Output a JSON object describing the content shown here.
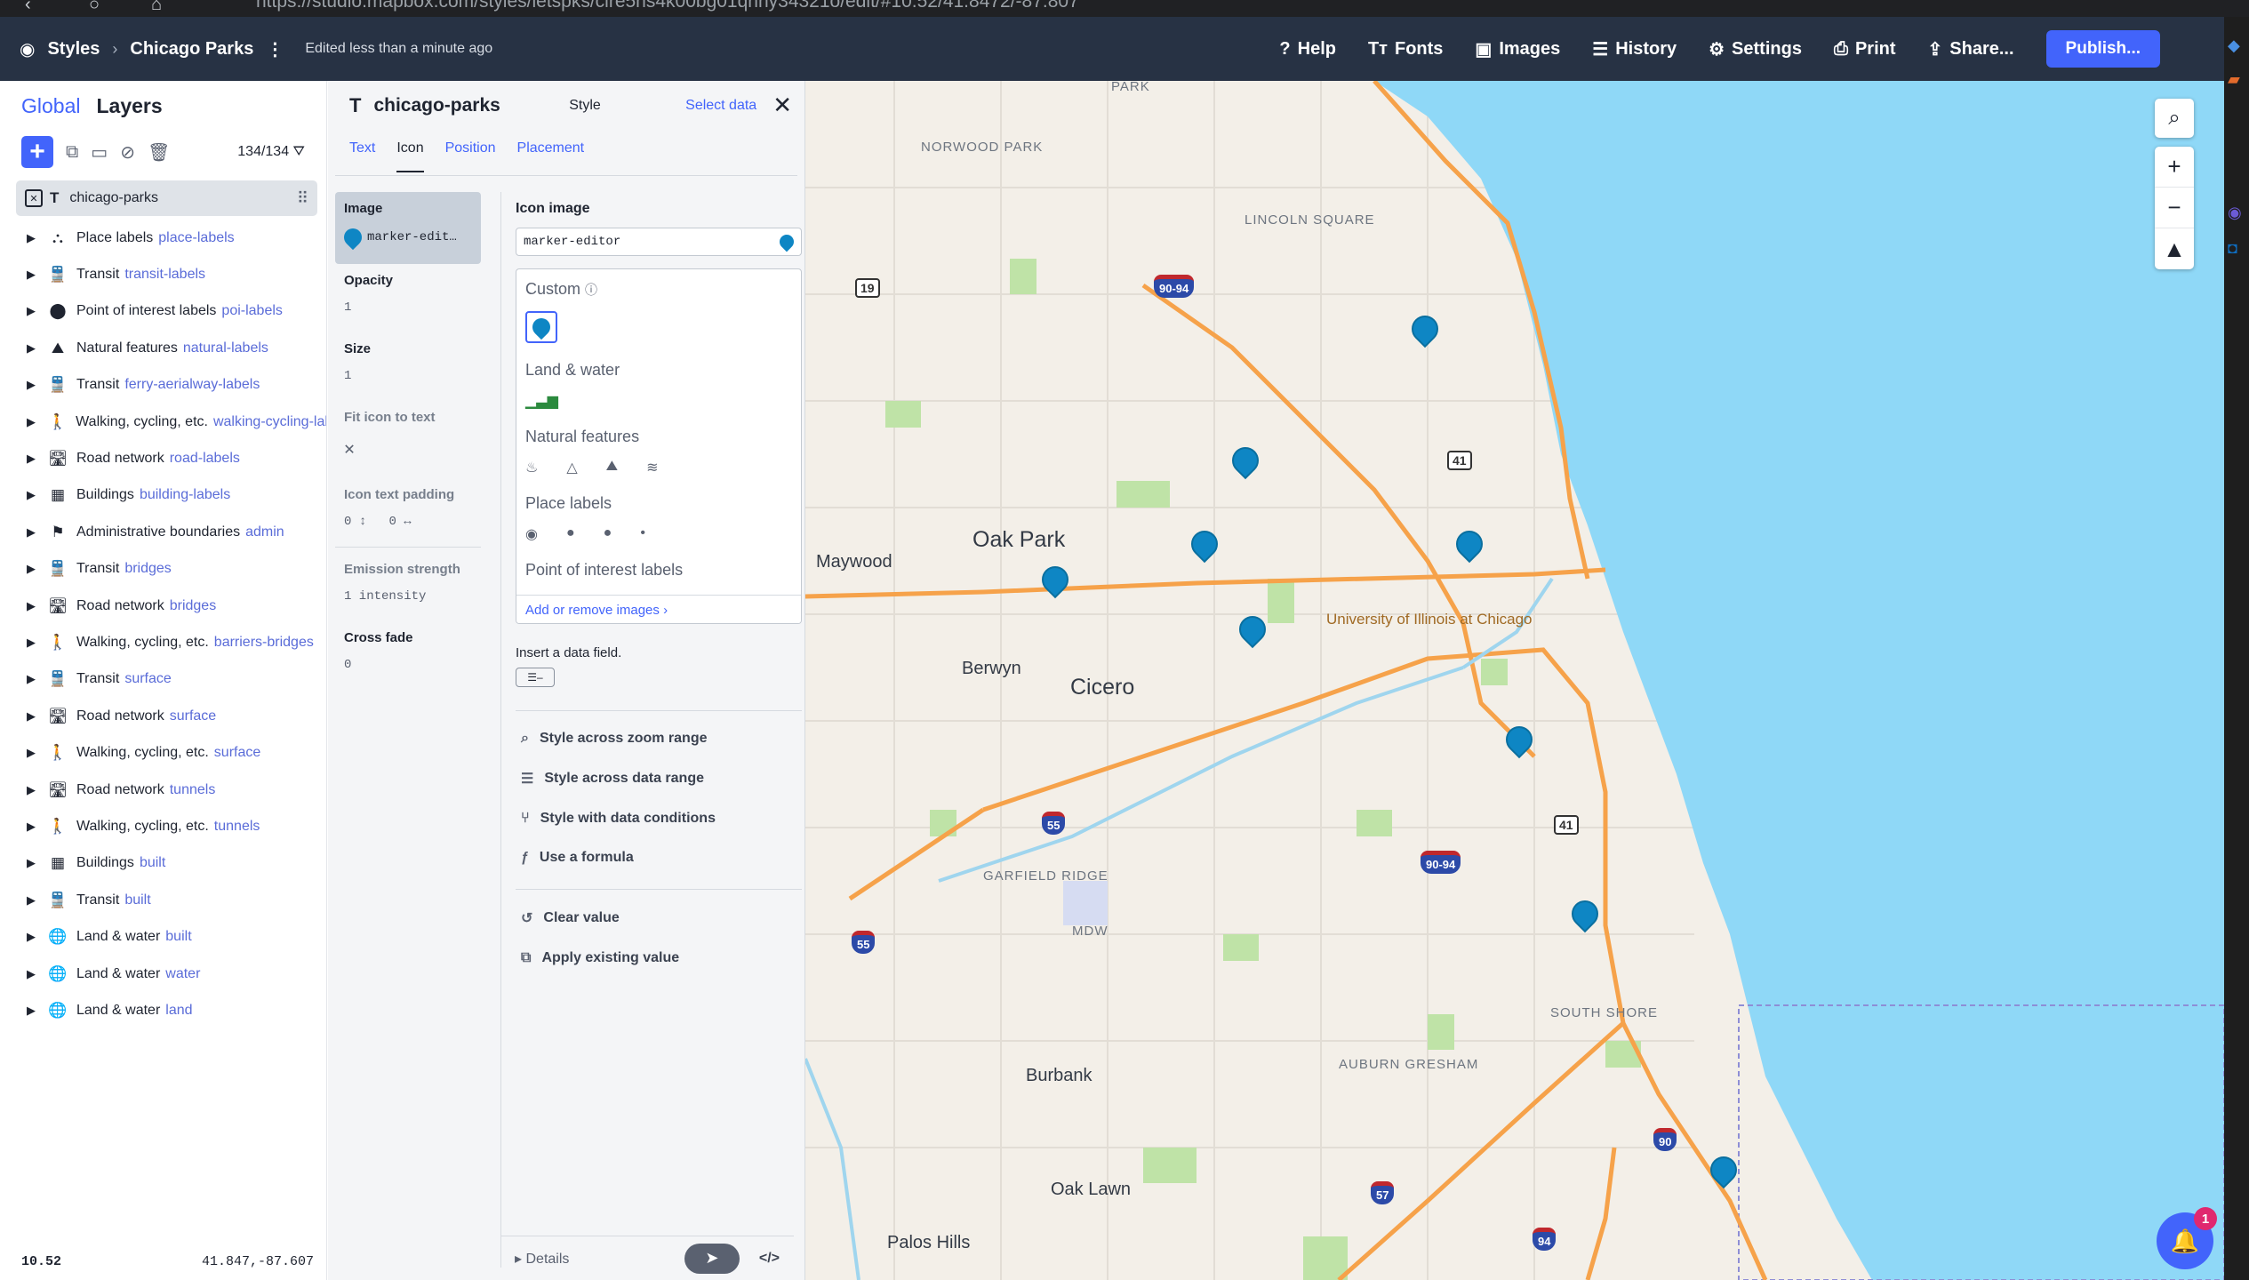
{
  "browser": {
    "url": "https://studio.mapbox.com/styles/letspks/clre5ns4k00bg01qnny34321o/edit/#10.52/41.8472/-87.807"
  },
  "topbar": {
    "styles": "Styles",
    "style_name": "Chicago Parks",
    "edited": "Edited less than a minute ago",
    "help": "Help",
    "fonts": "Fonts",
    "images": "Images",
    "history": "History",
    "settings": "Settings",
    "print": "Print",
    "share": "Share...",
    "publish": "Publish..."
  },
  "layers_panel": {
    "tab_global": "Global",
    "tab_layers": "Layers",
    "count": "134/134",
    "selected": "chicago-parks",
    "items": [
      {
        "group": "Place labels",
        "sub": "place-labels",
        "icon": "place-labels-icon"
      },
      {
        "group": "Transit",
        "sub": "transit-labels",
        "icon": "transit-icon"
      },
      {
        "group": "Point of interest labels",
        "sub": "poi-labels",
        "icon": "poi-icon"
      },
      {
        "group": "Natural features",
        "sub": "natural-labels",
        "icon": "natural-icon"
      },
      {
        "group": "Transit",
        "sub": "ferry-aerialway-labels",
        "icon": "transit-icon"
      },
      {
        "group": "Walking, cycling, etc.",
        "sub": "walking-cycling-lal",
        "icon": "walking-icon"
      },
      {
        "group": "Road network",
        "sub": "road-labels",
        "icon": "road-icon"
      },
      {
        "group": "Buildings",
        "sub": "building-labels",
        "icon": "building-icon"
      },
      {
        "group": "Administrative boundaries",
        "sub": "admin",
        "icon": "admin-flag-icon"
      },
      {
        "group": "Transit",
        "sub": "bridges",
        "icon": "transit-icon"
      },
      {
        "group": "Road network",
        "sub": "bridges",
        "icon": "road-icon"
      },
      {
        "group": "Walking, cycling, etc.",
        "sub": "barriers-bridges",
        "icon": "walking-icon"
      },
      {
        "group": "Transit",
        "sub": "surface",
        "icon": "transit-icon"
      },
      {
        "group": "Road network",
        "sub": "surface",
        "icon": "road-icon"
      },
      {
        "group": "Walking, cycling, etc.",
        "sub": "surface",
        "icon": "walking-icon"
      },
      {
        "group": "Road network",
        "sub": "tunnels",
        "icon": "road-icon"
      },
      {
        "group": "Walking, cycling, etc.",
        "sub": "tunnels",
        "icon": "walking-icon"
      },
      {
        "group": "Buildings",
        "sub": "built",
        "icon": "building-icon"
      },
      {
        "group": "Transit",
        "sub": "built",
        "icon": "transit-icon"
      },
      {
        "group": "Land & water",
        "sub": "built",
        "icon": "globe-icon"
      },
      {
        "group": "Land & water",
        "sub": "water",
        "icon": "globe-icon"
      },
      {
        "group": "Land & water",
        "sub": "land",
        "icon": "globe-icon"
      }
    ],
    "zoom": "10.52",
    "coords": "41.847,-87.607"
  },
  "props": {
    "layer_name": "chicago-parks",
    "tab_style": "Style",
    "tab_select_data": "Select data",
    "subtabs": {
      "text": "Text",
      "icon": "Icon",
      "position": "Position",
      "placement": "Placement"
    },
    "left": {
      "image_label": "Image",
      "image_value": "marker-edit…",
      "opacity_label": "Opacity",
      "opacity_value": "1",
      "size_label": "Size",
      "size_value": "1",
      "fit_label": "Fit icon to text",
      "padding_label": "Icon text padding",
      "padding_v": "0",
      "padding_h": "0",
      "emission_label": "Emission strength",
      "emission_value": "1 intensity",
      "crossfade_label": "Cross fade",
      "crossfade_value": "0"
    },
    "right": {
      "icon_image_heading": "Icon image",
      "icon_image_value": "marker-editor",
      "gallery": {
        "custom": "Custom",
        "land_water": "Land & water",
        "natural": "Natural features",
        "place": "Place labels",
        "poi": "Point of interest labels",
        "add_remove": "Add or remove images"
      },
      "insert": "Insert a data field.",
      "actions": {
        "zoom": "Style across zoom range",
        "data": "Style across data range",
        "conditions": "Style with data conditions",
        "formula": "Use a formula",
        "clear": "Clear value",
        "apply": "Apply existing value"
      },
      "details": "Details"
    }
  },
  "map": {
    "labels": {
      "norwood": "NORWOOD PARK",
      "lincoln": "LINCOLN SQUARE",
      "park": "PARK",
      "oakpark": "Oak Park",
      "maywood": "Maywood",
      "berwyn": "Berwyn",
      "cicero": "Cicero",
      "uic": "University of Illinois at Chicago",
      "garfield": "GARFIELD RIDGE",
      "mdw": "MDW",
      "southshore": "SOUTH SHORE",
      "auburn": "AUBURN GRESHAM",
      "burbank": "Burbank",
      "oaklawn": "Oak Lawn",
      "palos": "Palos Hills"
    },
    "shields": {
      "s19": "19",
      "i9094a": "90-94",
      "us41a": "41",
      "us41b": "41",
      "i55a": "55",
      "i55b": "55",
      "i9094b": "90-94",
      "i90": "90",
      "i57": "57",
      "i94": "94"
    },
    "notifications": "1",
    "colors": {
      "water": "#8fd8f7",
      "land": "#f3efe8",
      "park": "#bfe3a7",
      "highway": "#f6a24a",
      "pin": "#0e86c4",
      "accent": "#4264fb"
    }
  }
}
